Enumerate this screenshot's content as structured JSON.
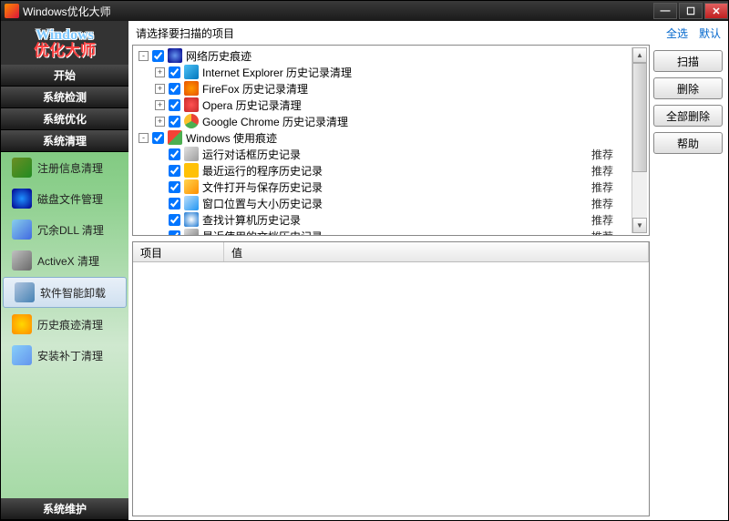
{
  "title": "Windows优化大师",
  "logo": {
    "line1": "Windows",
    "line2": "优化大师"
  },
  "categories": {
    "start": "开始",
    "detect": "系统检测",
    "optimize": "系统优化",
    "clean": "系统清理",
    "maintain": "系统维护"
  },
  "sideItems": [
    {
      "label": "注册信息清理",
      "icon": "ic1"
    },
    {
      "label": "磁盘文件管理",
      "icon": "ic2"
    },
    {
      "label": "冗余DLL 清理",
      "icon": "ic3"
    },
    {
      "label": "ActiveX 清理",
      "icon": "ic4"
    },
    {
      "label": "软件智能卸载",
      "icon": "ic5",
      "active": true
    },
    {
      "label": "历史痕迹清理",
      "icon": "ic6"
    },
    {
      "label": "安装补丁清理",
      "icon": "ic7"
    }
  ],
  "toolbar": {
    "prompt": "请选择要扫描的项目",
    "selectAll": "全选",
    "default": "默认"
  },
  "actions": {
    "scan": "扫描",
    "delete": "删除",
    "deleteAll": "全部删除",
    "help": "帮助"
  },
  "grid": {
    "col1": "项目",
    "col2": "值"
  },
  "recommend": "推荐",
  "tree": [
    {
      "depth": 0,
      "exp": "-",
      "chk": true,
      "icon": "n-net",
      "label": "网络历史痕迹"
    },
    {
      "depth": 1,
      "exp": "+",
      "chk": true,
      "icon": "n-ie",
      "label": "Internet Explorer 历史记录清理"
    },
    {
      "depth": 1,
      "exp": "+",
      "chk": true,
      "icon": "n-ff",
      "label": "FireFox 历史记录清理"
    },
    {
      "depth": 1,
      "exp": "+",
      "chk": true,
      "icon": "n-op",
      "label": "Opera 历史记录清理"
    },
    {
      "depth": 1,
      "exp": "+",
      "chk": true,
      "icon": "n-ch",
      "label": "Google Chrome 历史记录清理"
    },
    {
      "depth": 0,
      "exp": "-",
      "chk": true,
      "icon": "n-win",
      "label": "Windows 使用痕迹"
    },
    {
      "depth": 1,
      "exp": "",
      "chk": true,
      "icon": "n-dlg",
      "label": "运行对话框历史记录",
      "rec": true
    },
    {
      "depth": 1,
      "exp": "",
      "chk": true,
      "icon": "n-run",
      "label": "最近运行的程序历史记录",
      "rec": true
    },
    {
      "depth": 1,
      "exp": "",
      "chk": true,
      "icon": "n-fld",
      "label": "文件打开与保存历史记录",
      "rec": true
    },
    {
      "depth": 1,
      "exp": "",
      "chk": true,
      "icon": "n-wnd",
      "label": "窗口位置与大小历史记录",
      "rec": true
    },
    {
      "depth": 1,
      "exp": "",
      "chk": true,
      "icon": "n-sch",
      "label": "查找计算机历史记录",
      "rec": true
    },
    {
      "depth": 1,
      "exp": "",
      "chk": true,
      "icon": "n-doc",
      "label": "最近使用的文档历史记录",
      "rec": true
    }
  ]
}
